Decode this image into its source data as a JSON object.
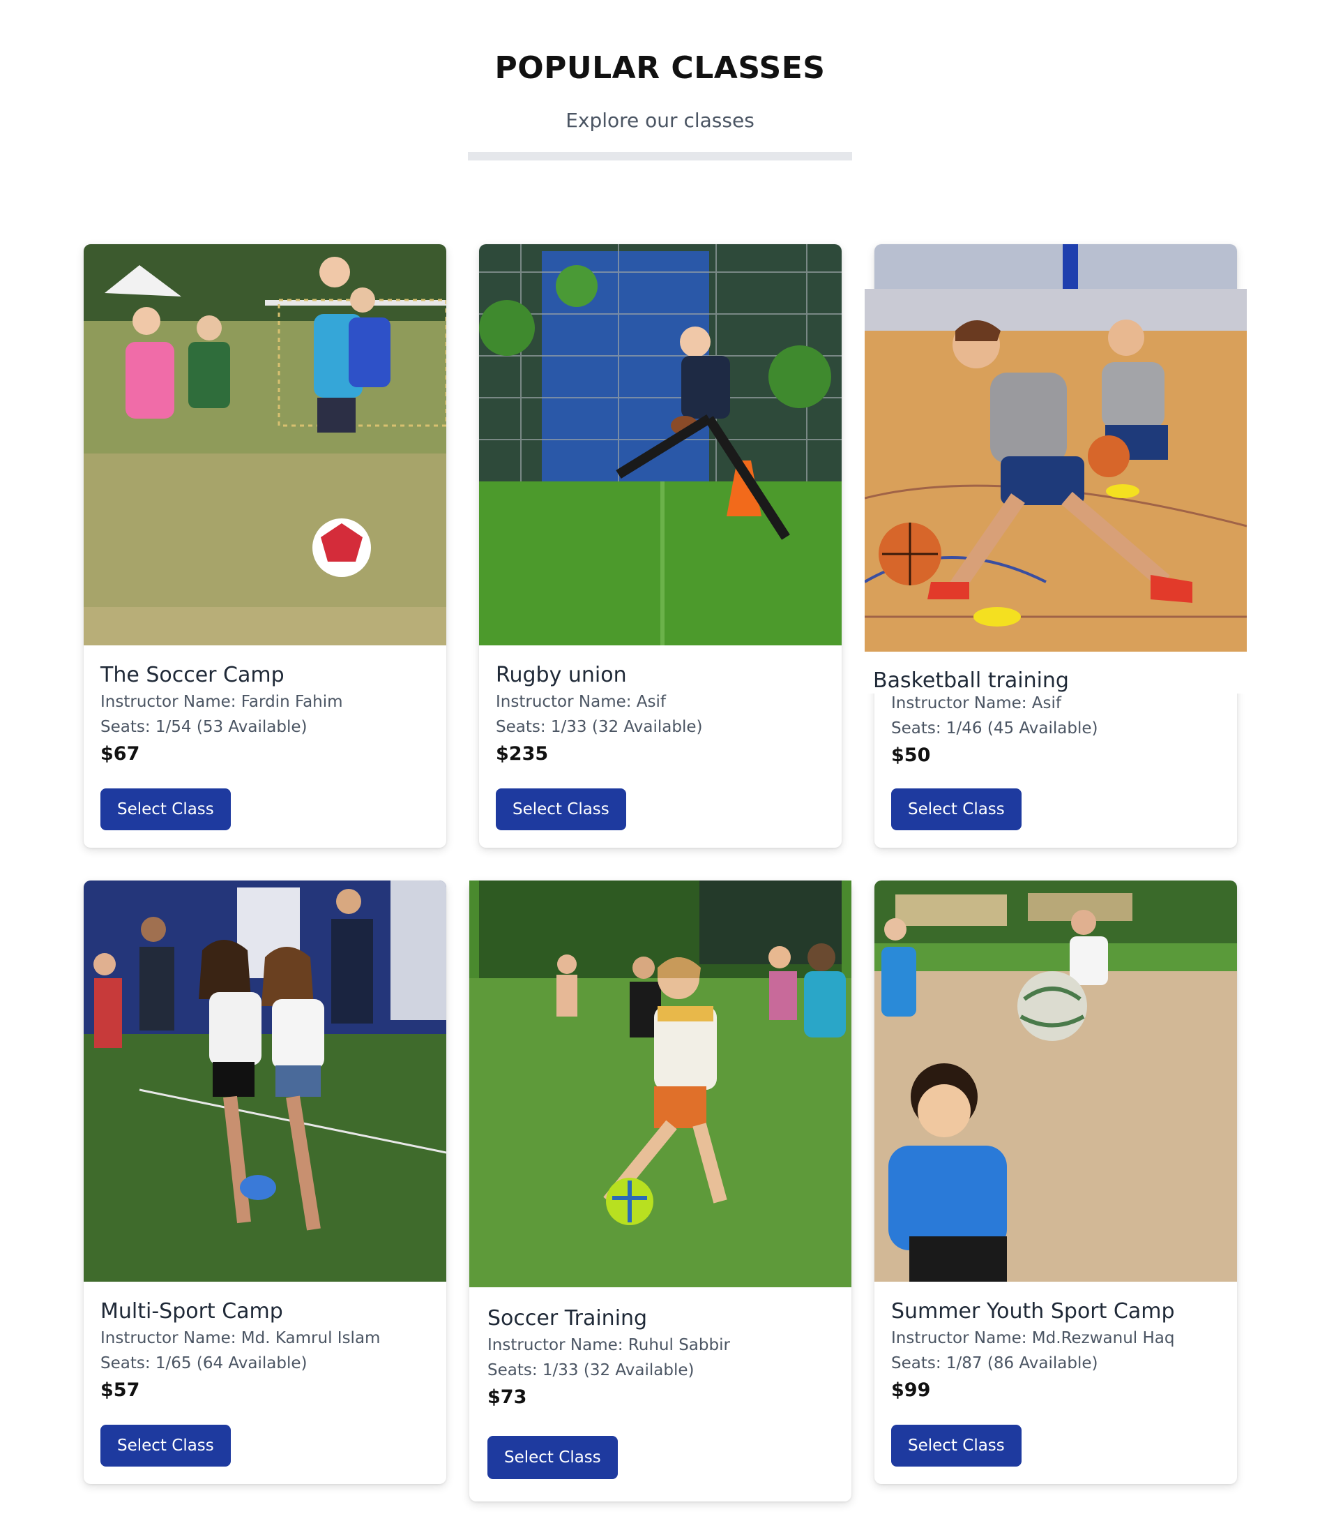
{
  "header": {
    "title": "POPULAR CLASSES",
    "subtitle": "Explore our classes"
  },
  "colors": {
    "button": "#1e3a9f",
    "divider": "#e5e7eb"
  },
  "classes": [
    {
      "name": "The Soccer Camp",
      "instructor": "Instructor Name: Fardin Fahim",
      "seats": "Seats: 1/54 (53 Available)",
      "price": "$67",
      "button": "Select Class",
      "image": "kids-playing-soccer-photo"
    },
    {
      "name": "Rugby union",
      "instructor": "Instructor Name: Asif",
      "seats": "Seats: 1/33 (32 Available)",
      "price": "$235",
      "button": "Select Class",
      "image": "boy-running-with-football-photo"
    },
    {
      "name": "Basketball training",
      "instructor": "Instructor Name: Asif",
      "seats": "Seats: 1/46 (45 Available)",
      "price": "$50",
      "button": "Select Class",
      "image": "kids-dribbling-basketball-photo"
    },
    {
      "name": "Multi-Sport Camp",
      "instructor": "Instructor Name: Md. Kamrul Islam",
      "seats": "Seats: 1/65 (64 Available)",
      "price": "$57",
      "button": "Select Class",
      "image": "girls-running-on-turf-photo"
    },
    {
      "name": "Soccer Training",
      "instructor": "Instructor Name: Ruhul Sabbir",
      "seats": "Seats: 1/33 (32 Available)",
      "price": "$73",
      "button": "Select Class",
      "image": "kids-soccer-on-grass-photo"
    },
    {
      "name": "Summer Youth Sport Camp",
      "instructor": "Instructor Name: Md.Rezwanul Haq",
      "seats": "Seats: 1/87 (86 Available)",
      "price": "$99",
      "button": "Select Class",
      "image": "girls-beach-volleyball-photo"
    }
  ]
}
